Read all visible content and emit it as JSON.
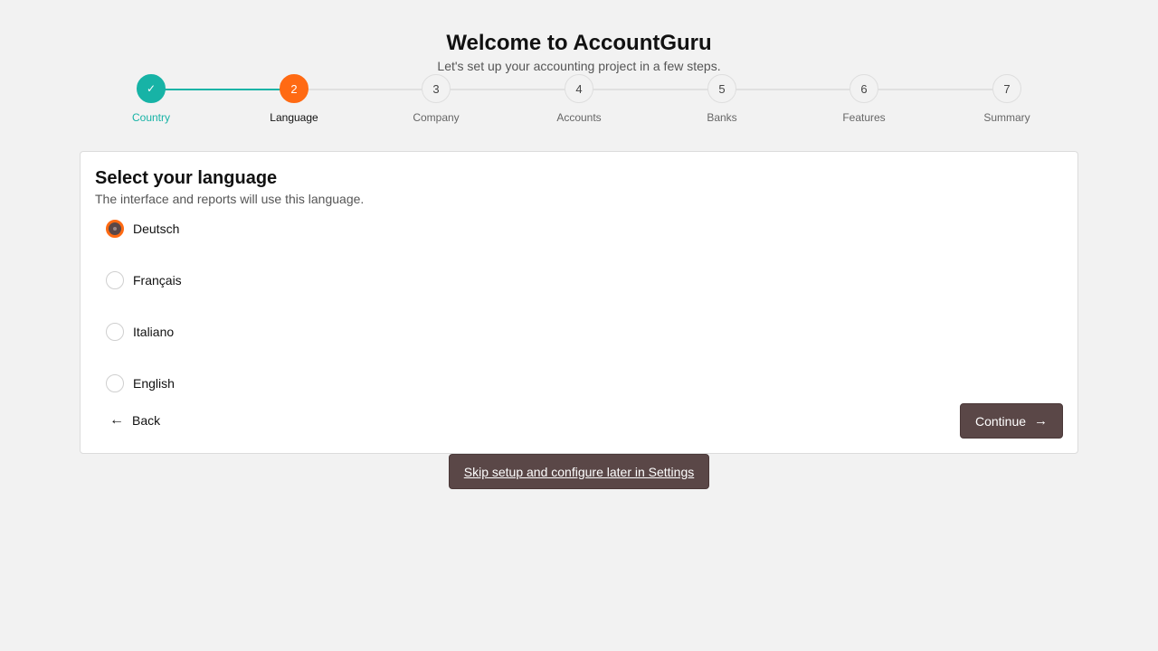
{
  "header": {
    "title": "Welcome to AccountGuru",
    "subtitle": "Let's set up your accounting project in a few steps."
  },
  "stepper": {
    "steps": [
      {
        "number": "✓",
        "label": "Country",
        "state": "done"
      },
      {
        "number": "2",
        "label": "Language",
        "state": "active"
      },
      {
        "number": "3",
        "label": "Company",
        "state": "pending"
      },
      {
        "number": "4",
        "label": "Accounts",
        "state": "pending"
      },
      {
        "number": "5",
        "label": "Banks",
        "state": "pending"
      },
      {
        "number": "6",
        "label": "Features",
        "state": "pending"
      },
      {
        "number": "7",
        "label": "Summary",
        "state": "pending"
      }
    ]
  },
  "card": {
    "title": "Select your language",
    "description": "The interface and reports will use this language.",
    "options": [
      {
        "label": "Deutsch",
        "checked": true
      },
      {
        "label": "Français",
        "checked": false
      },
      {
        "label": "Italiano",
        "checked": false
      },
      {
        "label": "English",
        "checked": false
      }
    ],
    "back_label": "Back",
    "continue_label": "Continue"
  },
  "skip_label": "Skip setup and configure later in Settings",
  "colors": {
    "done": "#17b3a6",
    "active": "#ff6a13",
    "button": "#5a4747",
    "background": "#f2f2f2"
  },
  "icons": {
    "back": "arrow-left-icon",
    "continue": "arrow-right-icon",
    "done_step": "check-icon"
  }
}
